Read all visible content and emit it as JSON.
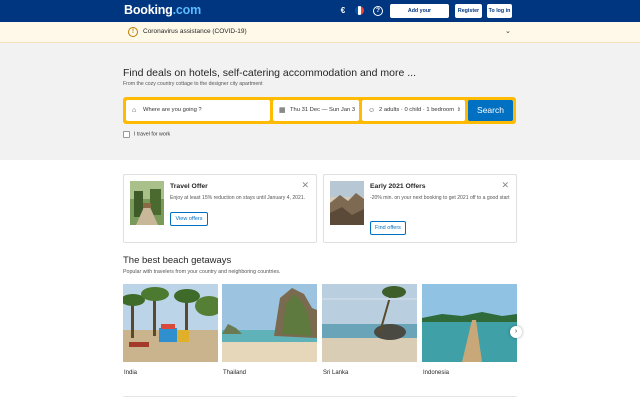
{
  "header": {
    "logo_main": "Booking",
    "logo_dot": ".com",
    "currency": "€",
    "add_property_label": "Add your establishment",
    "register_label": "Register",
    "login_label": "To log in"
  },
  "banner": {
    "text": "Coronavirus assistance (COVID-19)"
  },
  "search": {
    "title": "Find deals on hotels, self-catering accommodation and more ...",
    "subtitle": "From the cozy country cottage to the designer city apartment",
    "destination_placeholder": "Where are you going ?",
    "dates": "Thu 31 Dec — Sun Jan 3",
    "guests": "2 adults · 0 child · 1 bedroom",
    "search_button": "Search",
    "work_travel_label": "I travel for work"
  },
  "offers": [
    {
      "title": "Travel Offer",
      "description": "Enjoy at least 15% reduction on stays until January 4, 2021.",
      "button": "View offers"
    },
    {
      "title": "Early 2021 Offers",
      "description": "-20% min. on your next booking to get 2021 off to a good start",
      "button": "Find offers"
    }
  ],
  "beach": {
    "title": "The best beach getaways",
    "subtitle": "Popular with travelers from your country and neighboring countries.",
    "destinations": [
      "India",
      "Thailand",
      "Sri Lanka",
      "Indonesia"
    ]
  },
  "colors": {
    "brand_blue": "#003580",
    "accent_yellow": "#febb02",
    "action_blue": "#0071c2"
  }
}
